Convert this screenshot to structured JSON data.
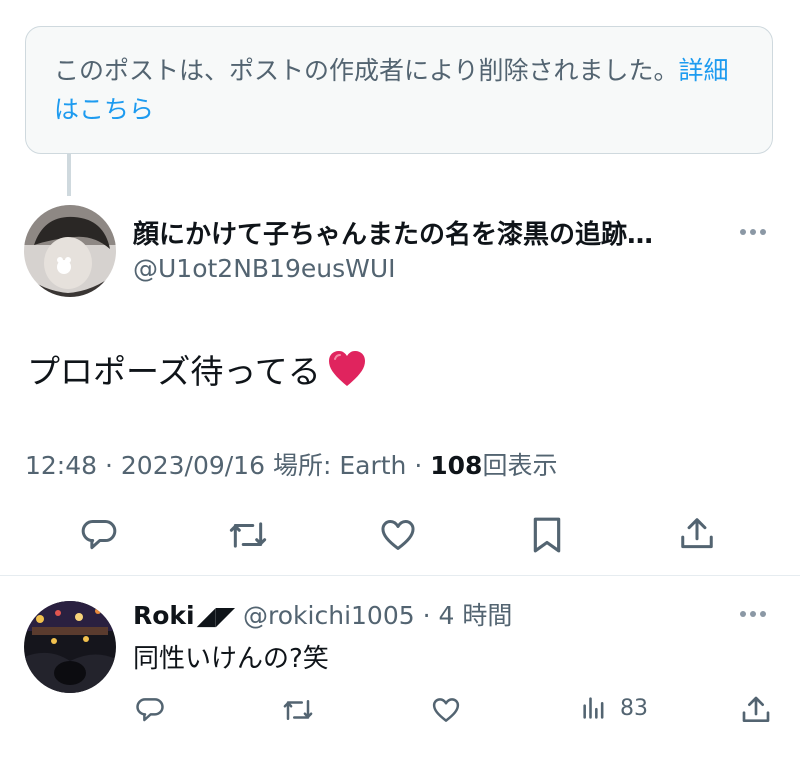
{
  "deleted_notice": {
    "text": "このポストは、ポストの作成者により削除されました。",
    "link": "詳細はこちら"
  },
  "post": {
    "author_name": "顔にかけて子ちゃんまたの名を漆黒の追跡…",
    "author_handle": "@U1ot2NB19eusWUI",
    "text": "プロポーズ待ってる",
    "emoji": "heart",
    "time": "12:48",
    "date": "2023/09/16",
    "location_label": "場所:",
    "location": "Earth",
    "views_count": "108",
    "views_label": "回表示",
    "separator": "·"
  },
  "actions": [
    "reply-icon",
    "repost-icon",
    "like-icon",
    "bookmark-icon",
    "share-icon"
  ],
  "reply": {
    "name": "Roki",
    "name_symbols": "◢◤",
    "handle": "@rokichi1005",
    "separator": "·",
    "time": "4 時間",
    "text": "同性いけんの?笑",
    "views": "83"
  },
  "colors": {
    "accent": "#1d9bf0",
    "secondary_text": "#536471",
    "heart": "#e0245e"
  }
}
